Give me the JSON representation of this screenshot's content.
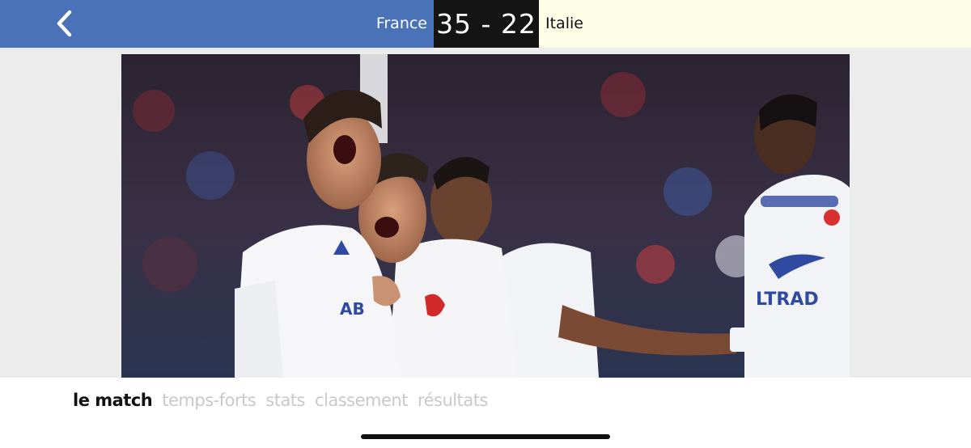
{
  "header": {
    "home_team": "France",
    "away_team": "Italie",
    "score": "35 - 22",
    "colors": {
      "home": "#4a72b8",
      "score_bg": "#141414",
      "away": "#fefde8"
    },
    "back_icon": "chevron-left-icon"
  },
  "photo": {
    "description_icon": "match-photo"
  },
  "tabs": [
    {
      "label": "le match",
      "active": true
    },
    {
      "label": "temps-forts",
      "active": false
    },
    {
      "label": "stats",
      "active": false
    },
    {
      "label": "classement",
      "active": false
    },
    {
      "label": "résultats",
      "active": false
    }
  ]
}
